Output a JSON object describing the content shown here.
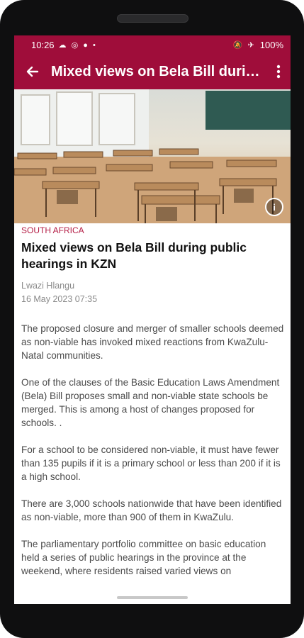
{
  "status_bar": {
    "time": "10:26",
    "left_icons": "☁ ◎ ● •",
    "right_icons": "🔕 ✈",
    "battery": "100%"
  },
  "app_bar": {
    "back_icon": "arrow-left-icon",
    "title": "Mixed views on Bela Bill during public hearings in KZN",
    "menu_icon": "more-vert-icon"
  },
  "hero": {
    "info_label": "i"
  },
  "article": {
    "category": "SOUTH AFRICA",
    "headline": "Mixed views on Bela Bill during public hearings in KZN",
    "author": "Lwazi Hlangu",
    "date": "16 May 2023 07:35",
    "paragraphs": [
      "The proposed closure and merger of smaller schools deemed as non-viable has invoked mixed reactions from KwaZulu-Natal communities.",
      "One of the clauses of the Basic Education Laws Amendment (Bela) Bill proposes small and non-viable state schools be merged. This is among a host of changes proposed for schools. .",
      "For a school to be considered non-viable, it must have fewer than 135 pupils if it is a primary school or less than 200 if it is a high school.",
      "There are 3,000 schools nationwide that have been identified as non-viable, more than 900 of them in KwaZulu.",
      "The parliamentary portfolio committee on basic education held a series of public hearings in the province at the weekend, where residents raised varied views on"
    ]
  },
  "colors": {
    "brand": "#9f0d3a",
    "category": "#b41d45"
  }
}
